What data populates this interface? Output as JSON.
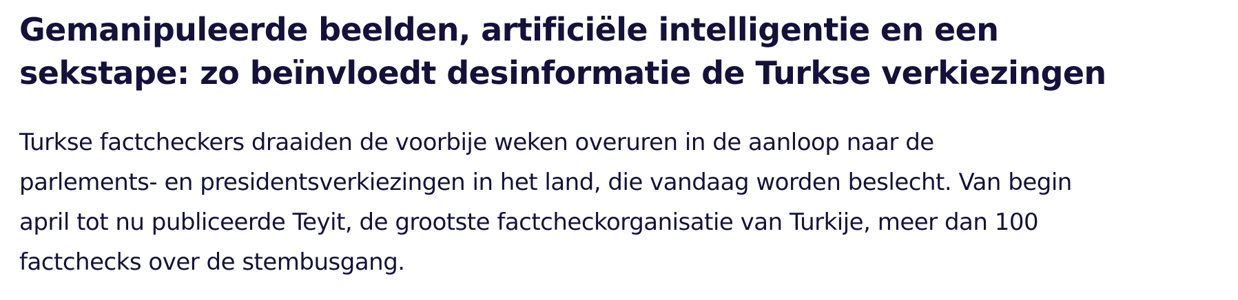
{
  "article": {
    "headline_line1": "Gemanipuleerde beelden, artificiële intelligentie en een",
    "headline_line2": "sekstape: zo beïnvloedt desinformatie de Turkse verkiezingen",
    "lead_line1": "Turkse factcheckers draaiden de voorbije weken overuren in de aanloop naar de",
    "lead_line2": "parlements- en presidentsverkiezingen in het land, die vandaag worden beslecht. Van begin",
    "lead_line3": "april tot nu publiceerde Teyit, de grootste factcheckorganisatie van Turkije, meer dan 100",
    "lead_line4": "factchecks over de stembusgang."
  },
  "colors": {
    "text": "#14123a",
    "background": "#ffffff"
  }
}
